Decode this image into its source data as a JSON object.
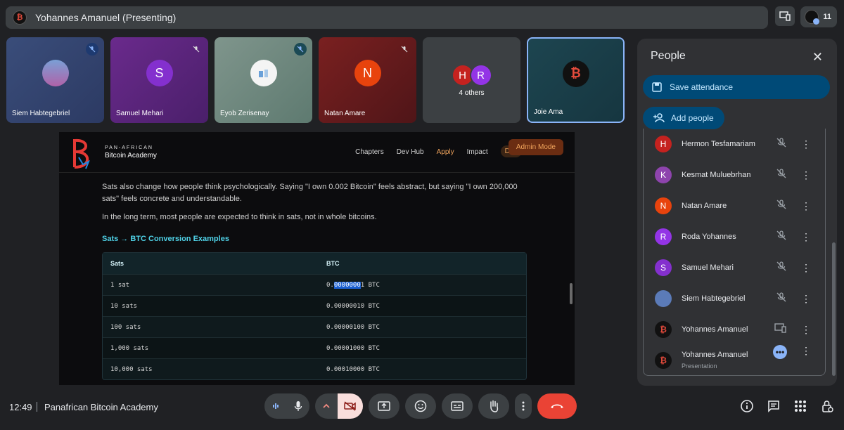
{
  "top_bar": {
    "presenter_title": "Yohannes Amanuel (Presenting)",
    "participant_count": "11"
  },
  "tiles": [
    {
      "name": "Siem Habtegebriel",
      "muted": true
    },
    {
      "name": "Samuel Mehari",
      "initial": "S",
      "muted": true
    },
    {
      "name": "Eyob Zerisenay",
      "muted": true
    },
    {
      "name": "Natan Amare",
      "initial": "N",
      "muted": true
    },
    {
      "others_label": "4 others",
      "initials": [
        "H",
        "R"
      ]
    },
    {
      "name": "Joie Ama",
      "active": true
    }
  ],
  "site": {
    "brand_line1": "PAN-AFRICAN",
    "brand_line2": "Bitcoin Academy",
    "nav": [
      "Chapters",
      "Dev Hub",
      "Apply",
      "Impact",
      "Don"
    ],
    "admin_mode": "Admin Mode",
    "paragraph1": "Sats also change how people think psychologically. Saying \"I own 0.002 Bitcoin\" feels abstract, but saying \"I own 200,000 sats\" feels concrete and understandable.",
    "paragraph2": "In the long term, most people are expected to think in sats, not in whole bitcoins.",
    "table_heading": "Sats → BTC Conversion Examples",
    "table_headers": [
      "Sats",
      "BTC"
    ],
    "rows": [
      {
        "sats": "1 sat",
        "btc_prefix": "0.",
        "btc_selected": "0000000",
        "btc_rest": "1 BTC"
      },
      {
        "sats": "10 sats",
        "btc": "0.00000010 BTC"
      },
      {
        "sats": "100 sats",
        "btc": "0.00000100 BTC"
      },
      {
        "sats": "1,000 sats",
        "btc": "0.00001000 BTC"
      },
      {
        "sats": "10,000 sats",
        "btc": "0.00010000 BTC"
      }
    ]
  },
  "panel": {
    "title": "People",
    "save_attendance": "Save attendance",
    "add_people": "Add people",
    "people": [
      {
        "name": "Hermon Tesfamariam",
        "initial": "H",
        "color": "#c5221f",
        "state": "muted"
      },
      {
        "name": "Kesmat Muluebrhan",
        "initial": "K",
        "color": "#8e44ad",
        "state": "muted"
      },
      {
        "name": "Natan Amare",
        "initial": "N",
        "color": "#e8430d",
        "state": "muted"
      },
      {
        "name": "Roda Yohannes",
        "initial": "R",
        "color": "#9334e6",
        "state": "muted"
      },
      {
        "name": "Samuel Mehari",
        "initial": "S",
        "color": "#8430ce",
        "state": "muted"
      },
      {
        "name": "Siem Habtegebriel",
        "initial": "",
        "color": "#5b7bb8",
        "state": "muted"
      },
      {
        "name": "Yohannes Amanuel",
        "initial": "",
        "color": "#111111",
        "state": "presenting-device"
      },
      {
        "name": "Yohannes Amanuel",
        "sub": "Presentation",
        "initial": "",
        "color": "#111111",
        "state": "more"
      }
    ]
  },
  "bottom": {
    "time": "12:49",
    "meeting_name": "Panafrican Bitcoin Academy"
  }
}
